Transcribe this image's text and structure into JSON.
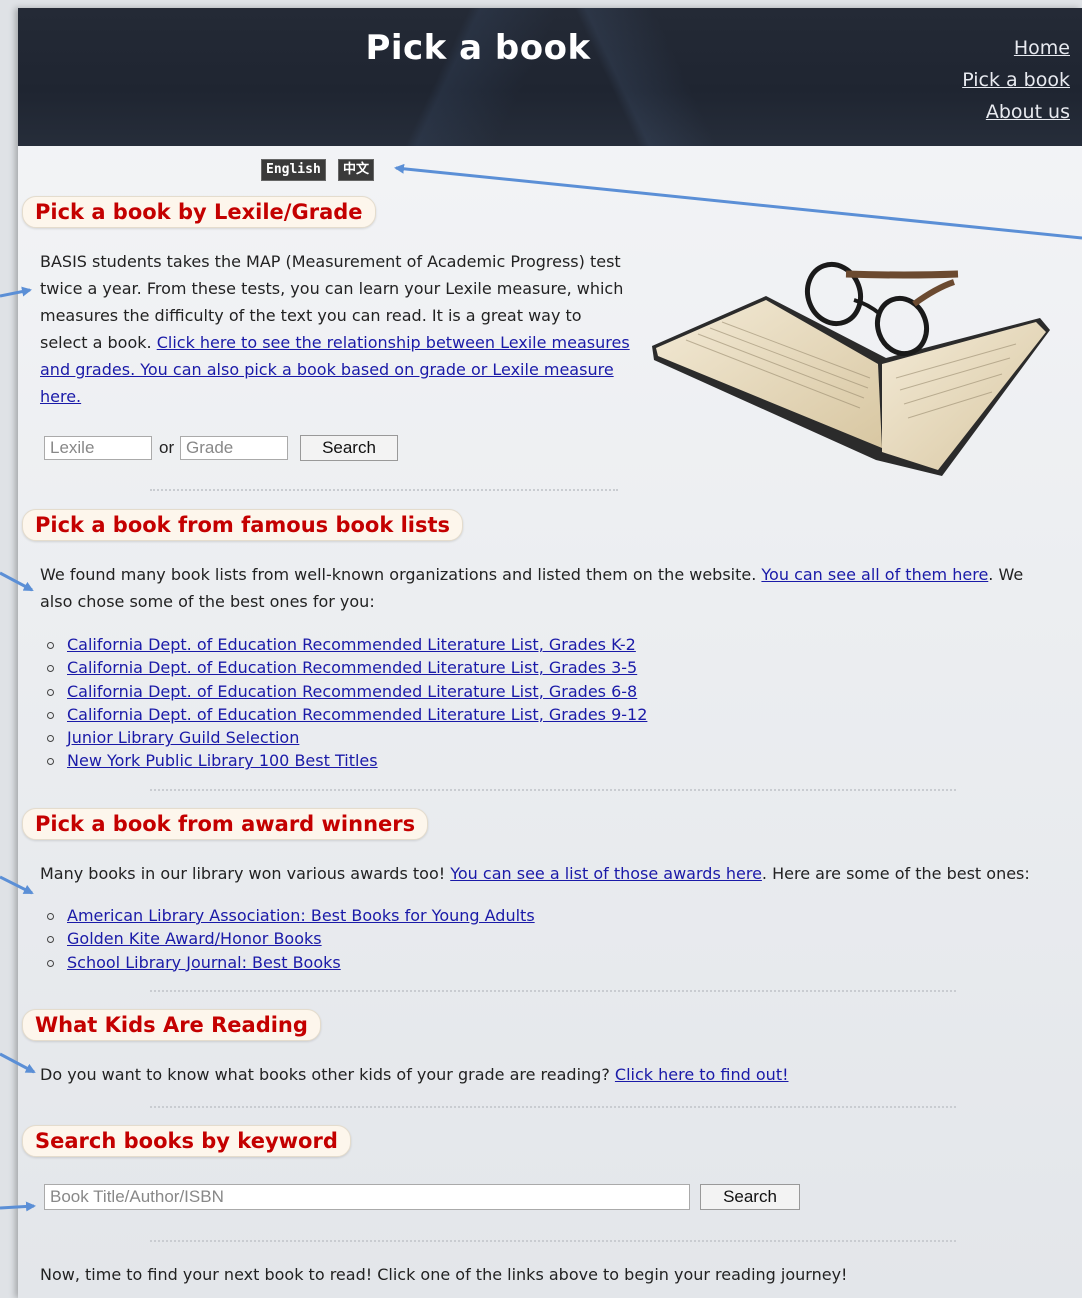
{
  "header": {
    "title": "Pick a book",
    "nav": [
      "Home",
      "Pick a book",
      "About us"
    ]
  },
  "languages": [
    "English",
    "中文"
  ],
  "lexile_section": {
    "title": "Pick a book by Lexile/Grade",
    "text": "BASIS students takes the MAP (Measurement of Academic Progress) test twice a year. From these tests, you can learn your Lexile measure, which measures the difficulty of the text you can read. It is a great way to select a book.",
    "link": "Click here to see the relationship between Lexile measures and grades. You can also pick a book based on grade or Lexile measure here.",
    "lexile_placeholder": "Lexile",
    "or_label": "or",
    "grade_placeholder": "Grade",
    "search_label": "Search"
  },
  "lists_section": {
    "title": "Pick a book from famous book lists",
    "text_before": "We found many book lists from well-known organizations and listed them on the website.",
    "link": "You can see all of them here",
    "text_after": ". We also chose some of the best ones for you:",
    "items": [
      "California Dept. of Education Recommended Literature List, Grades K-2",
      "California Dept. of Education Recommended Literature List, Grades 3-5",
      "California Dept. of Education Recommended Literature List, Grades 6-8",
      "California Dept. of Education Recommended Literature List, Grades 9-12",
      "Junior Library Guild Selection",
      "New York Public Library 100 Best Titles"
    ]
  },
  "awards_section": {
    "title": "Pick a book from award winners",
    "text_before": "Many books in our library won various awards too!",
    "link": "You can see a list of those awards here",
    "text_after": ". Here are some of the best ones:",
    "items": [
      "American Library Association: Best Books for Young Adults",
      "Golden Kite Award/Honor Books",
      "School Library Journal: Best Books"
    ]
  },
  "kids_section": {
    "title": "What Kids Are Reading",
    "text": "Do you want to know what books other kids of your grade are reading?",
    "link": "Click here to find out!"
  },
  "keyword_section": {
    "title": "Search books by keyword",
    "placeholder": "Book Title/Author/ISBN",
    "search_label": "Search"
  },
  "footer_text": "Now, time to find your next book to read! Click one of the links above to begin your reading journey!",
  "colors": {
    "header_bg": "#242a36",
    "section_title": "#c40000",
    "link": "#1a1aa8",
    "annotation_arrow": "#5b8fd6"
  }
}
